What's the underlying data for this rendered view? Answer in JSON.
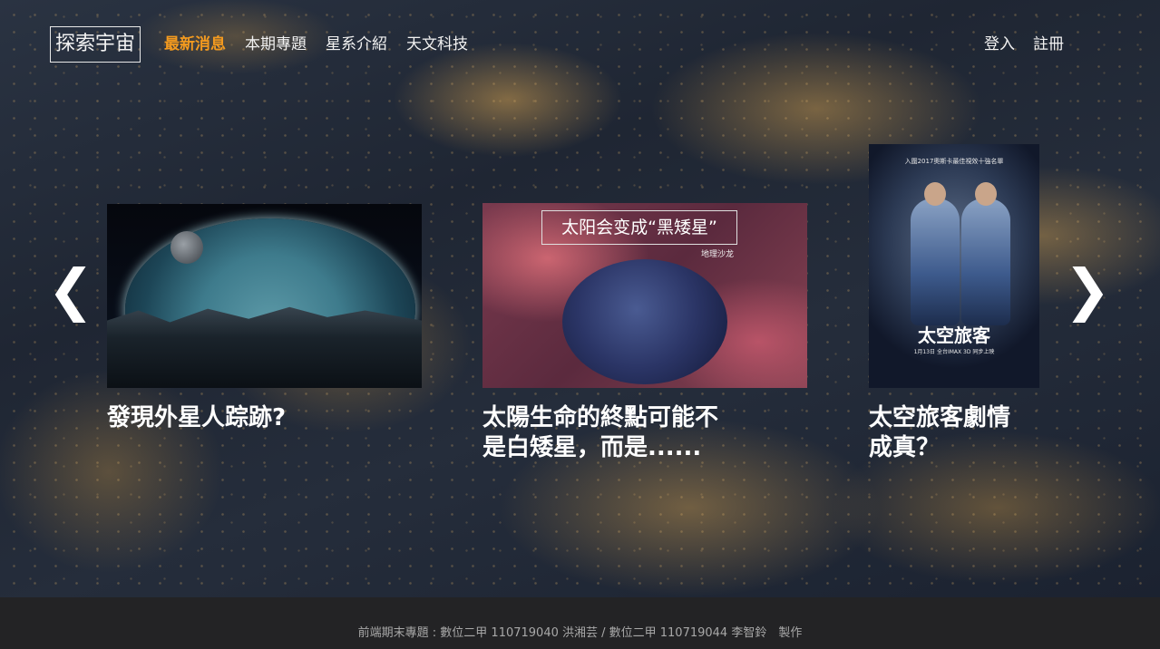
{
  "nav": {
    "logo": "探索宇宙",
    "links": [
      "最新消息",
      "本期專題",
      "星系介紹",
      "天文科技"
    ],
    "active_index": 0,
    "active_color": "#f39a1f",
    "auth": {
      "login": "登入",
      "register": "註冊"
    }
  },
  "carousel": {
    "prev_icon": "chevron-left-icon",
    "next_icon": "chevron-right-icon",
    "prev_glyph": "❮",
    "next_glyph": "❯",
    "cards": [
      {
        "title": "發現外星人踪跡?"
      },
      {
        "title_line1": "太陽生命的終點可能不",
        "title_line2": "是白矮星，而是......",
        "image_caption": "太阳会变成“黑矮星”",
        "image_sub": "地理沙龙"
      },
      {
        "title_line1": "太空旅客劇情",
        "title_line2": "成真？",
        "poster_top": "入圍2017奧斯卡最佳視效十強名單",
        "poster_title": "太空旅客",
        "poster_date": "1月13日 全台IMAX 3D 同步上映"
      }
    ]
  },
  "footer": {
    "text": "前端期末專題 : 數位二甲 110719040 洪湘芸 / 數位二甲 110719044 李智鈴　製作"
  }
}
